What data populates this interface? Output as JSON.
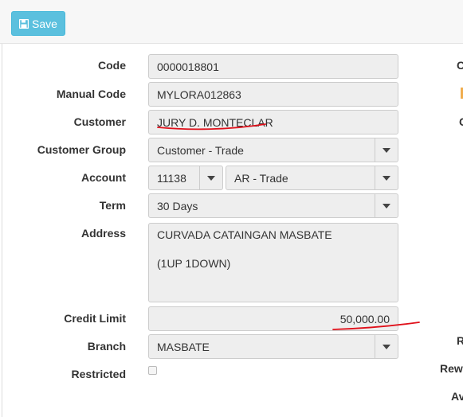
{
  "toolbar": {
    "save_label": "Save",
    "save_icon": "floppy-disk-icon"
  },
  "form": {
    "code": {
      "label": "Code",
      "value": "0000018801"
    },
    "manual_code": {
      "label": "Manual Code",
      "value": "MYLORA012863"
    },
    "customer": {
      "label": "Customer",
      "value": "JURY D. MONTECLAR"
    },
    "customer_group": {
      "label": "Customer Group",
      "value": "Customer - Trade"
    },
    "account": {
      "label": "Account",
      "code_value": "11138",
      "name_value": "AR - Trade"
    },
    "term": {
      "label": "Term",
      "value": "30 Days"
    },
    "address": {
      "label": "Address",
      "value": "CURVADA CATAINGAN MASBATE\n\n(1UP 1DOWN)"
    },
    "credit_limit": {
      "label": "Credit Limit",
      "value": "50,000.00"
    },
    "branch": {
      "label": "Branch",
      "value": "MASBATE"
    },
    "restricted": {
      "label": "Restricted",
      "checked": false
    }
  },
  "right_column_labels": [
    "C",
    "C",
    "R",
    "Rewa",
    "Av"
  ],
  "colors": {
    "save_button": "#5bc0de",
    "annotation": "#e0101a",
    "field_bg": "#eeeeee"
  }
}
